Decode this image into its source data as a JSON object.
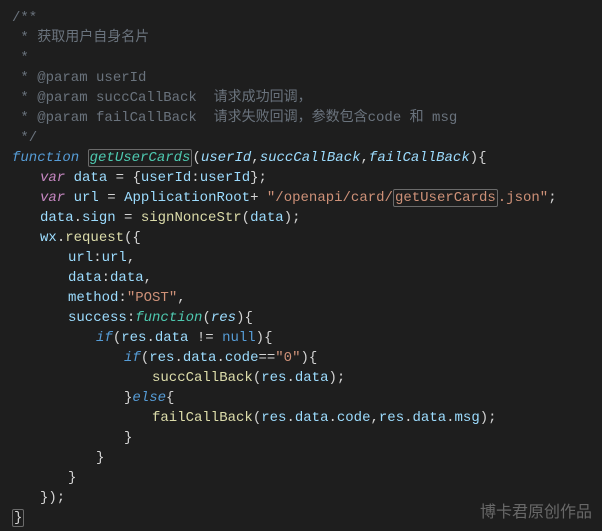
{
  "comment": {
    "open": "/**",
    "l1": " * 获取用户自身名片",
    "l2": " *",
    "l3": " * @param userId",
    "l4": " * @param succCallBack  请求成功回调，",
    "l5": " * @param failCallBack  请求失败回调，参数包含code 和 msg",
    "close": " */"
  },
  "kw": {
    "function": "function",
    "var": "var",
    "if": "if",
    "else": "else",
    "null": "null"
  },
  "fn": {
    "name": "getUserCards",
    "p1": "userId",
    "p2": "succCallBack",
    "p3": "failCallBack"
  },
  "ids": {
    "data": "data",
    "userId": "userId",
    "url": "url",
    "ApplicationRoot": "ApplicationRoot",
    "sign": "sign",
    "signNonceStr": "signNonceStr",
    "wx": "wx",
    "request": "request",
    "method": "method",
    "success": "success",
    "res": "res",
    "code": "code",
    "msg": "msg",
    "succCallBack": "succCallBack",
    "failCallBack": "failCallBack"
  },
  "str": {
    "path": "\"/openapi/card/",
    "json": ".json\"",
    "post": "\"POST\"",
    "zero": "\"0\""
  },
  "ops": {
    "eq": " = ",
    "plus": "+ ",
    "neq": " != ",
    "eqeq": "=="
  },
  "watermark": "博卡君原创作品"
}
